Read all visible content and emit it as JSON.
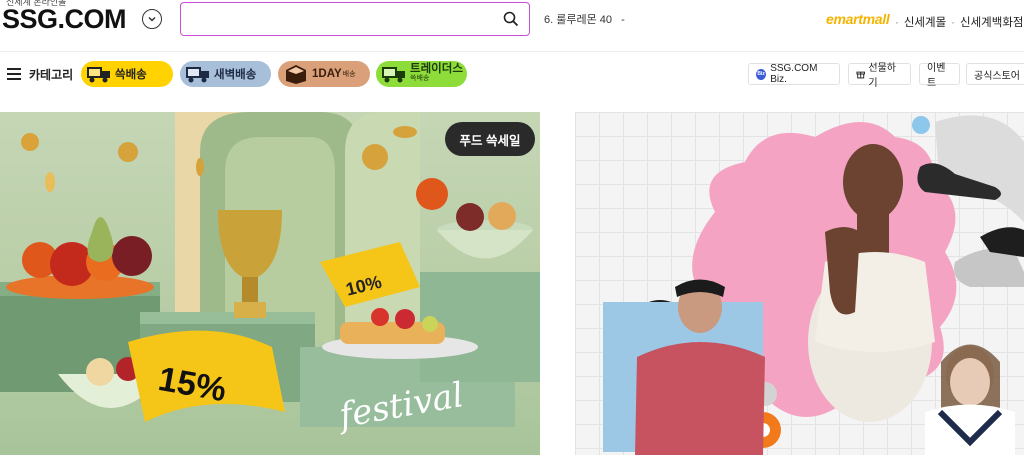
{
  "header": {
    "top_tag": "신세계 온라인몰",
    "logo": "SSG.COM",
    "search": {
      "value": "",
      "placeholder": ""
    },
    "trending": {
      "rank": "6.",
      "keyword": "룰루레몬 40",
      "caret": "-"
    },
    "emart_mall": {
      "part1": "emart",
      "part2": "mall"
    },
    "partner_links": [
      "신세계몰",
      "신세계백화점"
    ]
  },
  "nav": {
    "category_label": "카테고리",
    "delivery_pills": [
      {
        "label": "쓱배송",
        "color": "#ffd200"
      },
      {
        "label": "새벽배송",
        "color": "#a8bfd9"
      },
      {
        "label": "1DAY",
        "sub": "배송",
        "color": "#d9a07a"
      },
      {
        "label": "트레이더스",
        "sub": "쓱배송",
        "color": "#8edc3a"
      }
    ],
    "right_chips": [
      "SSG.COM Biz.",
      "선물하기",
      "이벤트",
      "공식스토어"
    ],
    "biz_icon_text": "Biz"
  },
  "banners": {
    "left": {
      "badge": "푸드 쓱세일",
      "discount_main": "15%",
      "discount_secondary": "10%",
      "script_word": "festival"
    }
  },
  "colors": {
    "search_border": "#c94fd6",
    "accent_yellow": "#ffd200",
    "emart": "#f5b400"
  },
  "icons": [
    "chevron-down-icon",
    "search-icon",
    "hamburger-icon",
    "truck-icon",
    "gift-icon",
    "biz-icon"
  ]
}
